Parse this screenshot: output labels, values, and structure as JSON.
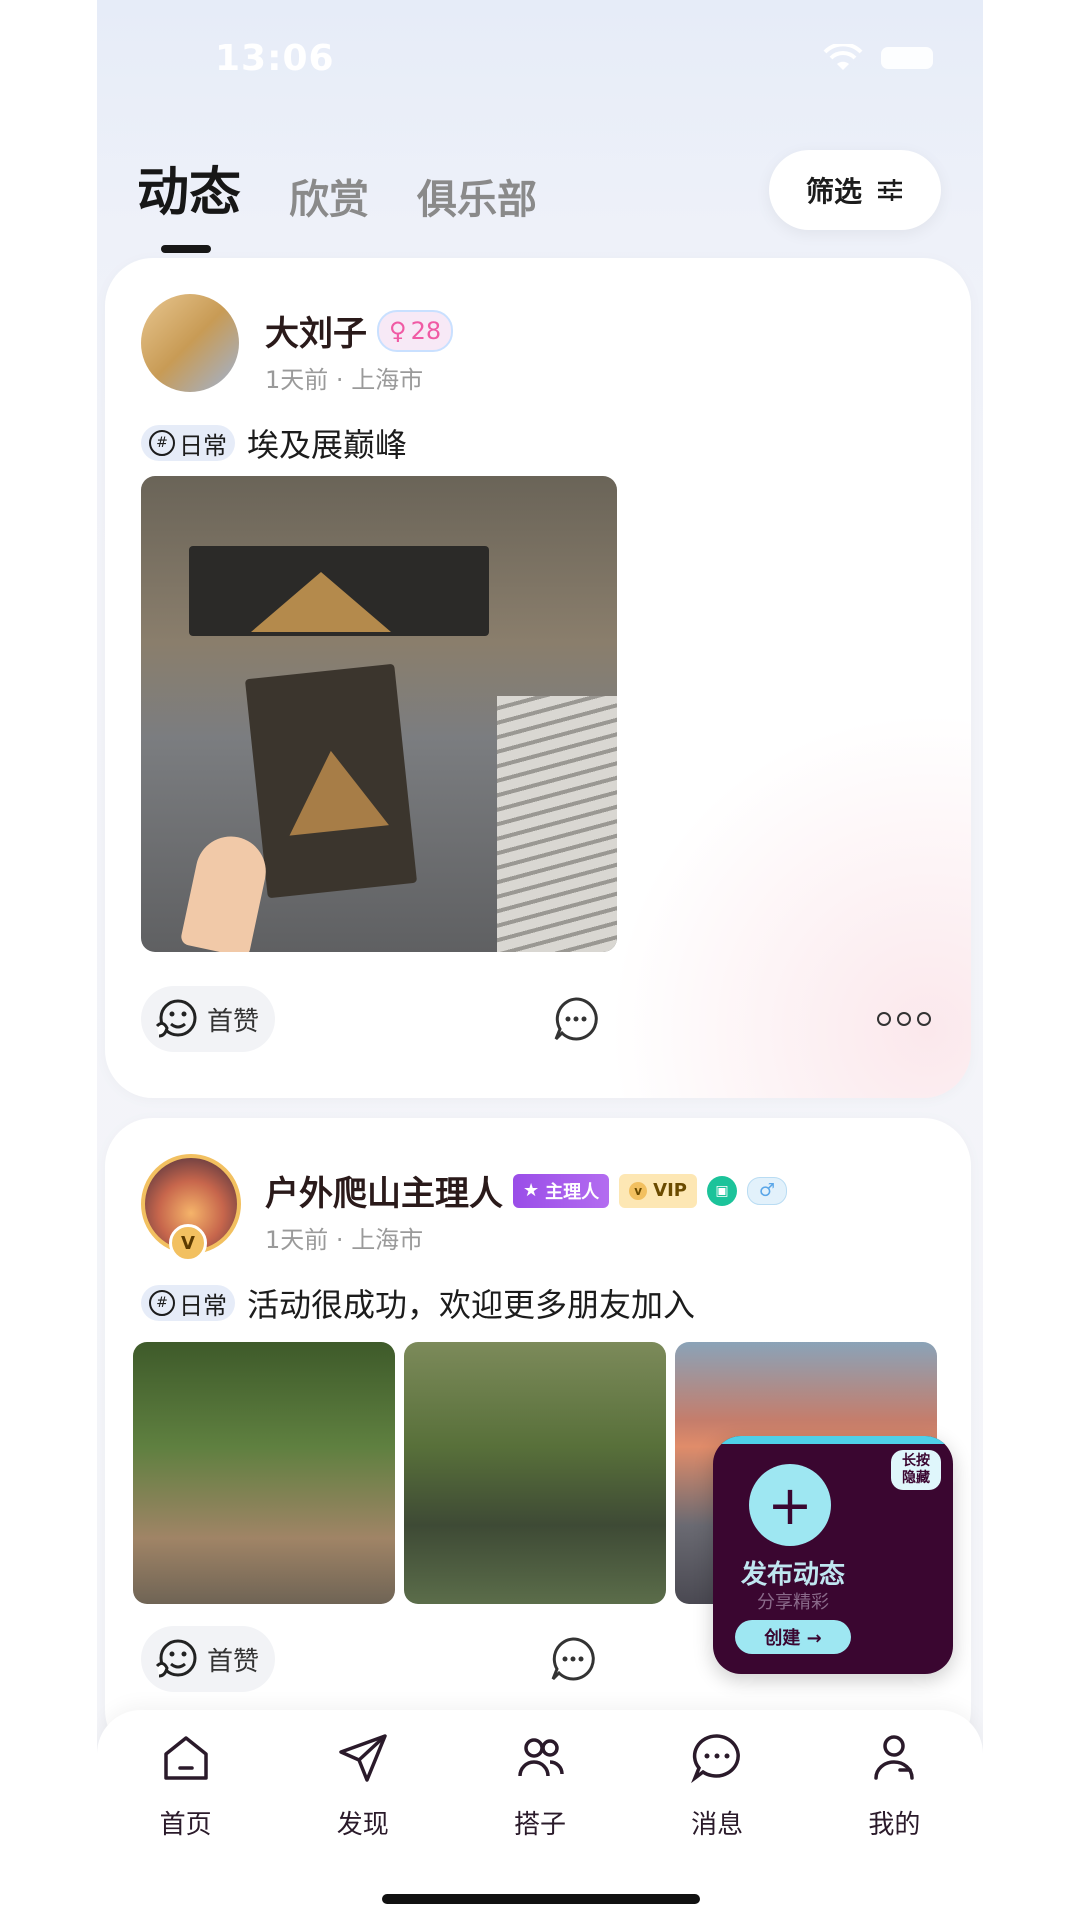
{
  "status": {
    "time": "13:06"
  },
  "tabs": [
    {
      "label": "动态",
      "active": true
    },
    {
      "label": "欣赏",
      "active": false
    },
    {
      "label": "俱乐部",
      "active": false
    }
  ],
  "filter": {
    "label": "筛选"
  },
  "posts": [
    {
      "username": "大刘子",
      "gender_age": "28",
      "time": "1天前",
      "location": "上海市",
      "tag": "日常",
      "text": "埃及展巅峰",
      "like_label": "首赞"
    },
    {
      "username": "户外爬山主理人",
      "role_badge": "主理人",
      "vip_badge": "VIP",
      "avatar_badge": "V",
      "time": "1天前",
      "location": "上海市",
      "tag": "日常",
      "text": "活动很成功，欢迎更多朋友加入",
      "like_label": "首赞"
    }
  ],
  "fab": {
    "hide_hint_line1": "长按",
    "hide_hint_line2": "隐藏",
    "title": "发布动态",
    "subtitle": "分享精彩",
    "create_label": "创建 →"
  },
  "bottom_nav": [
    {
      "label": "首页",
      "icon": "home-icon"
    },
    {
      "label": "发现",
      "icon": "paper-plane-icon"
    },
    {
      "label": "搭子",
      "icon": "people-icon"
    },
    {
      "label": "消息",
      "icon": "chat-icon"
    },
    {
      "label": "我的",
      "icon": "user-icon"
    }
  ]
}
